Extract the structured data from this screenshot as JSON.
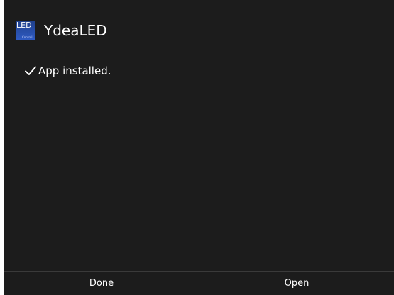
{
  "header": {
    "icon_text": "LED",
    "icon_subtext": "Control",
    "title": "YdeaLED"
  },
  "status": {
    "message": "App installed.",
    "icon": "check-icon"
  },
  "footer": {
    "done_label": "Done",
    "open_label": "Open"
  },
  "colors": {
    "background": "#1c1c1c",
    "text": "#ffffff",
    "icon_bg": "#2f5bc4",
    "divider": "#3a3a3a"
  }
}
